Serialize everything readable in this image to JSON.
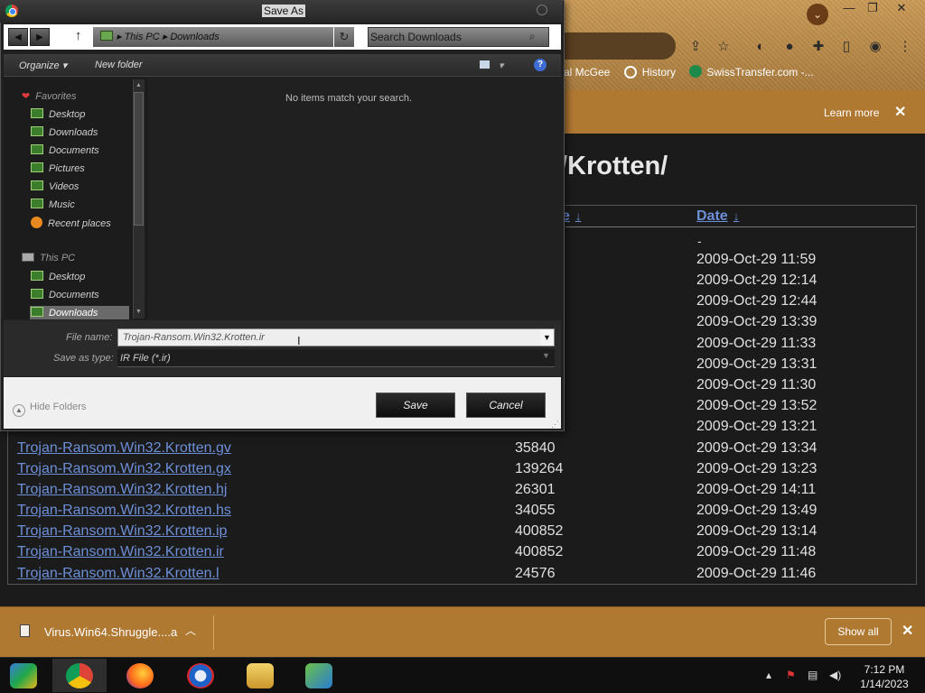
{
  "chrome": {
    "bookmarks": [
      "ral McGee",
      "History",
      "SwissTransfer.com -..."
    ],
    "infobar": {
      "learn_more": "Learn more",
      "close": "✕"
    },
    "page_heading": "/Krotten/",
    "columns": {
      "size": "e",
      "date": "Date"
    },
    "dash": "-",
    "dates_upper": [
      "2009-Oct-29 11:59",
      "2009-Oct-29 12:14",
      "2009-Oct-29 12:44",
      "2009-Oct-29 13:39",
      "2009-Oct-29 11:33",
      "2009-Oct-29 13:31",
      "2009-Oct-29 11:30",
      "2009-Oct-29 13:52",
      "2009-Oct-29 13:21"
    ],
    "files": [
      {
        "name": "Trojan-Ransom.Win32.Krotten.gv",
        "size": "35840",
        "date": "2009-Oct-29 13:34"
      },
      {
        "name": "Trojan-Ransom.Win32.Krotten.gx",
        "size": "139264",
        "date": "2009-Oct-29 13:23"
      },
      {
        "name": "Trojan-Ransom.Win32.Krotten.hj",
        "size": "26301",
        "date": "2009-Oct-29 14:11"
      },
      {
        "name": "Trojan-Ransom.Win32.Krotten.hs",
        "size": "34055",
        "date": "2009-Oct-29 13:49"
      },
      {
        "name": "Trojan-Ransom.Win32.Krotten.ip",
        "size": "400852",
        "date": "2009-Oct-29 13:14"
      },
      {
        "name": "Trojan-Ransom.Win32.Krotten.ir",
        "size": "400852",
        "date": "2009-Oct-29 11:48"
      },
      {
        "name": "Trojan-Ransom.Win32.Krotten.l",
        "size": "24576",
        "date": "2009-Oct-29 11:46"
      }
    ]
  },
  "download_bar": {
    "file_name": "Virus.Win64.Shruggle....a",
    "show_all": "Show all",
    "close": "✕"
  },
  "dialog": {
    "title": "Save As",
    "breadcrumb": [
      "This PC",
      "Downloads"
    ],
    "search_placeholder": "Search Downloads",
    "toolbar": {
      "organize": "Organize",
      "new_folder": "New folder"
    },
    "nav": {
      "favorites_label": "Favorites",
      "favorites": [
        "Desktop",
        "Downloads",
        "Documents",
        "Pictures",
        "Videos",
        "Music",
        "Recent places"
      ],
      "this_pc_label": "This PC",
      "this_pc": [
        "Desktop",
        "Documents",
        "Downloads"
      ]
    },
    "empty_message": "No items match your search.",
    "file_name_label": "File name:",
    "file_name_value": "Trojan-Ransom.Win32.Krotten.ir",
    "save_type_label": "Save as type:",
    "save_type_value": "IR File (*.ir)",
    "hide_folders": "Hide Folders",
    "save_button": "Save",
    "cancel_button": "Cancel"
  },
  "taskbar": {
    "time": "7:12 PM",
    "date": "1/14/2023"
  }
}
